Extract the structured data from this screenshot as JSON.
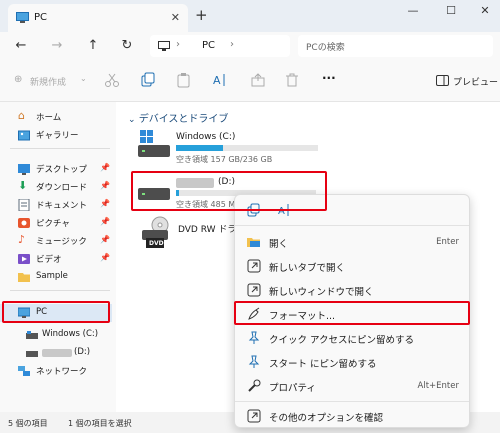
{
  "window": {
    "tab_title": "PC",
    "tab_close": "✕",
    "new_tab": "+",
    "minimize": "—",
    "maximize": "☐",
    "close": "✕"
  },
  "address": {
    "path_root": "PC",
    "separator": "›",
    "search_placeholder": "PCの検索"
  },
  "toolbar": {
    "new_label": "新規作成",
    "more_label": "···",
    "preview_label": "プレビュー"
  },
  "nav": {
    "home": "ホーム",
    "gallery": "ギャラリー",
    "desktop": "デスクトップ",
    "downloads": "ダウンロード",
    "documents": "ドキュメント",
    "pictures": "ピクチャ",
    "music": "ミュージック",
    "videos": "ビデオ",
    "sample": "Sample",
    "pc": "PC",
    "windows_c": "Windows (C:)",
    "d_drive": "(D:)",
    "network": "ネットワーク"
  },
  "content": {
    "section_title": "デバイスとドライブ",
    "drive_c": {
      "name": "Windows (C:)",
      "free": "空き領域 157 GB/236 GB",
      "used_fraction": 0.33
    },
    "drive_d": {
      "name": "(D:)",
      "free": "空き領域 485 M",
      "used_fraction": 0.02
    },
    "dvd": {
      "name": "DVD RW ドライブ",
      "badge": "DVD"
    }
  },
  "context_menu": {
    "open": "開く",
    "open_shortcut": "Enter",
    "open_new_tab": "新しいタブで開く",
    "open_new_window": "新しいウィンドウで開く",
    "format": "フォーマット...",
    "pin_quick": "クイック アクセスにピン留めする",
    "pin_start": "スタート にピン留めする",
    "properties": "プロパティ",
    "properties_shortcut": "Alt+Enter",
    "more_options": "その他のオプションを確認"
  },
  "status": {
    "item_count": "5 個の項目",
    "selected": "1 個の項目を選択"
  },
  "colors": {
    "accent": "#26a0da",
    "highlight": "#e60012"
  }
}
